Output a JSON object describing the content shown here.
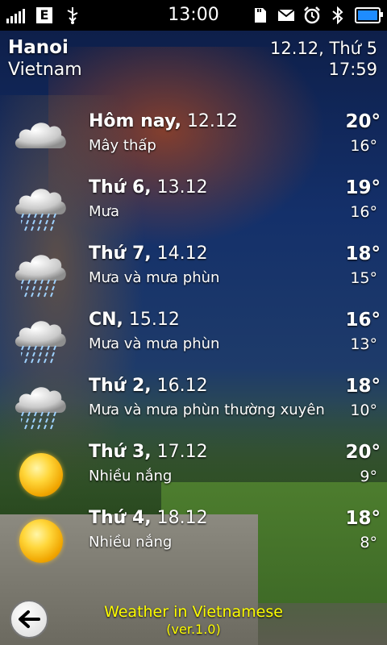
{
  "status_bar": {
    "time": "13:00",
    "network_label": "E",
    "icons": [
      "signal-icon",
      "edge-network-icon",
      "usb-icon",
      "sd-card-icon",
      "message-icon",
      "alarm-icon",
      "bluetooth-icon",
      "battery-icon"
    ]
  },
  "location": {
    "city": "Hanoi",
    "country": "Vietnam",
    "date": "12.12, Thứ 5",
    "time": "17:59"
  },
  "forecast": [
    {
      "day": "Hôm nay,",
      "date": "12.12",
      "desc": "Mây thấp",
      "high": "20°",
      "low": "16°",
      "icon": "cloud-icon"
    },
    {
      "day": "Thứ 6,",
      "date": "13.12",
      "desc": "Mưa",
      "high": "19°",
      "low": "16°",
      "icon": "rain-cloud-icon"
    },
    {
      "day": "Thứ 7,",
      "date": "14.12",
      "desc": "Mưa và mưa phùn",
      "high": "18°",
      "low": "15°",
      "icon": "rain-cloud-icon"
    },
    {
      "day": "CN,",
      "date": "15.12",
      "desc": "Mưa và mưa phùn",
      "high": "16°",
      "low": "13°",
      "icon": "rain-cloud-icon"
    },
    {
      "day": "Thứ 2,",
      "date": "16.12",
      "desc": "Mưa và mưa phùn thường xuyên",
      "high": "18°",
      "low": "10°",
      "icon": "rain-cloud-icon"
    },
    {
      "day": "Thứ 3,",
      "date": "17.12",
      "desc": "Nhiều nắng",
      "high": "20°",
      "low": "9°",
      "icon": "sun-icon"
    },
    {
      "day": "Thứ 4,",
      "date": "18.12",
      "desc": "Nhiều nắng",
      "high": "18°",
      "low": "8°",
      "icon": "sun-icon"
    }
  ],
  "footer": {
    "title": "Weather in Vietnamese",
    "version": "(ver.1.0)"
  },
  "colors": {
    "footer_text": "#ffff00",
    "battery_fill": "#1e8cff"
  }
}
